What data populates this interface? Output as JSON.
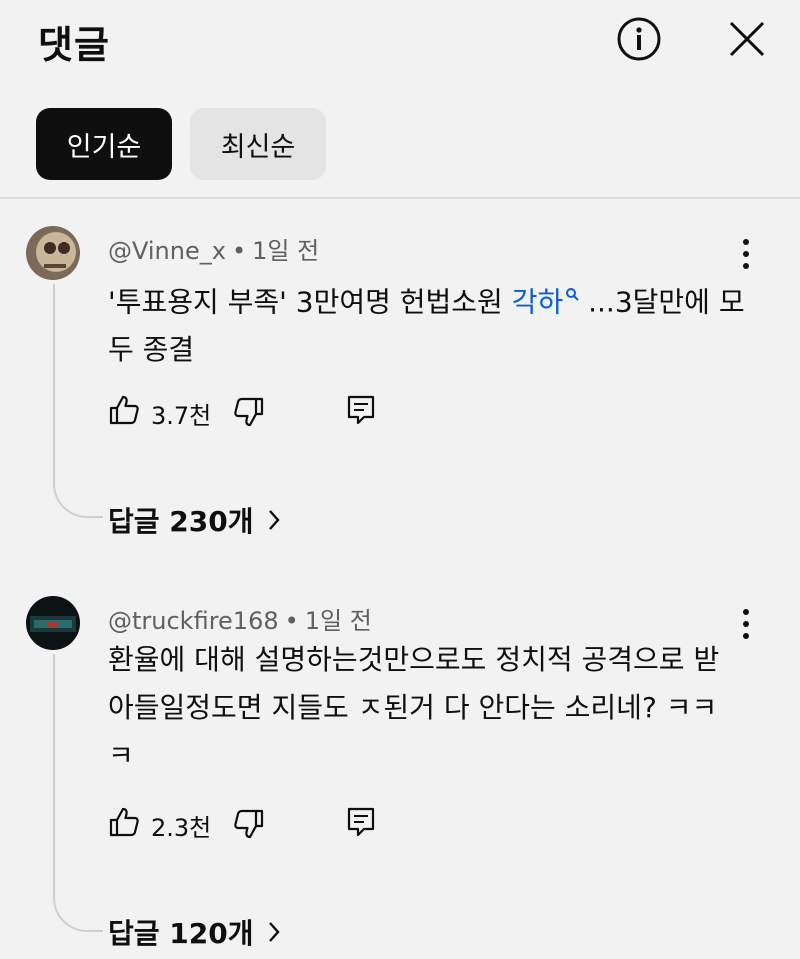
{
  "header": {
    "title": "댓글",
    "info_icon": "info-icon",
    "close_icon": "close-icon"
  },
  "sort_chips": [
    {
      "label": "인기순",
      "selected": true
    },
    {
      "label": "최신순",
      "selected": false
    }
  ],
  "comments": [
    {
      "author": "@Vinne_x",
      "time": "1일 전",
      "text_before": "'투표용지 부족' 3만여명 헌법소원 ",
      "link": "각하",
      "text_after": " ...3달만에 모두 종결",
      "likes": "3.7천",
      "replies": "답글 230개"
    },
    {
      "author": "@truckfire168",
      "time": "1일 전",
      "text": "환율에 대해 설명하는것만으로도 정치적 공격으로 받아들일정도면 지들도 ㅈ된거 다 안다는 소리네? ㅋㅋㅋ",
      "likes": "2.3천",
      "replies": "답글 120개"
    }
  ],
  "colors": {
    "background": "#f2f2f2",
    "chip_active": "#0f0f0f",
    "chip_inactive": "#e4e4e4",
    "link": "#065fd4",
    "meta": "#606060"
  }
}
